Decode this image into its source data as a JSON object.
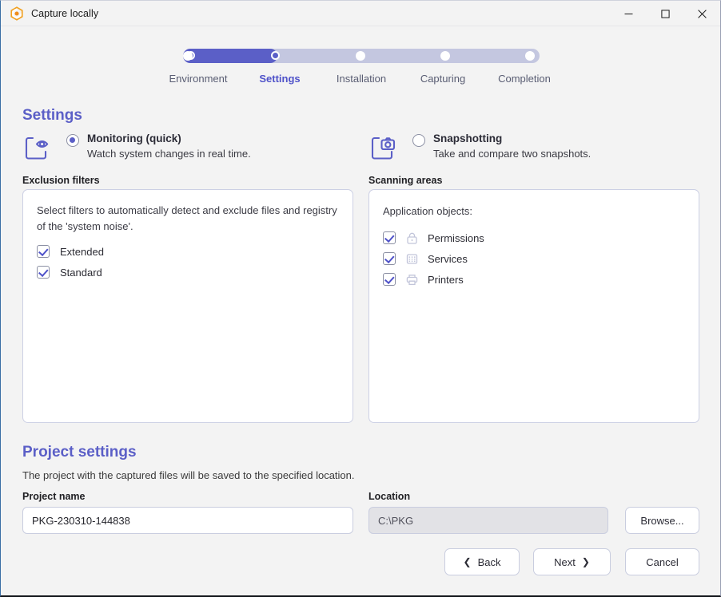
{
  "window": {
    "title": "Capture locally",
    "app_icon": "hexagon-c-logo-icon",
    "controls": {
      "minimize": "minimize-icon",
      "maximize": "maximize-icon",
      "close": "close-icon"
    }
  },
  "colors": {
    "accent": "#5b5fc7",
    "accent_text": "#4f52c9",
    "track_inactive": "#c4c7e0",
    "panel_border": "#ccd0e4",
    "page_bg": "#f3f3f3",
    "disabled_field_bg": "#e2e2e6"
  },
  "stepper": {
    "current_index": 1,
    "steps": [
      {
        "label": "Environment",
        "state": "done"
      },
      {
        "label": "Settings",
        "state": "current"
      },
      {
        "label": "Installation",
        "state": "todo"
      },
      {
        "label": "Capturing",
        "state": "todo"
      },
      {
        "label": "Completion",
        "state": "todo"
      }
    ]
  },
  "settings": {
    "title": "Settings",
    "modes": [
      {
        "name": "Monitoring (quick)",
        "description": "Watch system changes in real time.",
        "icon": "eye-in-frame-icon",
        "selected": true
      },
      {
        "name": "Snapshotting",
        "description": "Take and compare two snapshots.",
        "icon": "camera-in-frame-icon",
        "selected": false
      }
    ],
    "exclusion_filters": {
      "label": "Exclusion filters",
      "description": "Select filters to automatically detect and exclude files and registry of the 'system noise'.",
      "items": [
        {
          "label": "Extended",
          "checked": true
        },
        {
          "label": "Standard",
          "checked": true
        }
      ]
    },
    "scanning_areas": {
      "label": "Scanning areas",
      "description": "Application objects:",
      "items": [
        {
          "label": "Permissions",
          "checked": true,
          "icon": "lock-icon"
        },
        {
          "label": "Services",
          "checked": true,
          "icon": "grid-services-icon"
        },
        {
          "label": "Printers",
          "checked": true,
          "icon": "printer-icon"
        }
      ]
    }
  },
  "project_settings": {
    "title": "Project settings",
    "description": "The project with the captured files will be saved to the specified location.",
    "project_name": {
      "label": "Project name",
      "value": "PKG-230310-144838",
      "placeholder": "Project name"
    },
    "location": {
      "label": "Location",
      "value": "C:\\PKG",
      "placeholder": "Location",
      "readonly": true
    },
    "browse_label": "Browse..."
  },
  "footer": {
    "back_label": "Back",
    "next_label": "Next",
    "cancel_label": "Cancel",
    "back_icon": "chevron-left-icon",
    "next_icon": "chevron-right-icon"
  }
}
